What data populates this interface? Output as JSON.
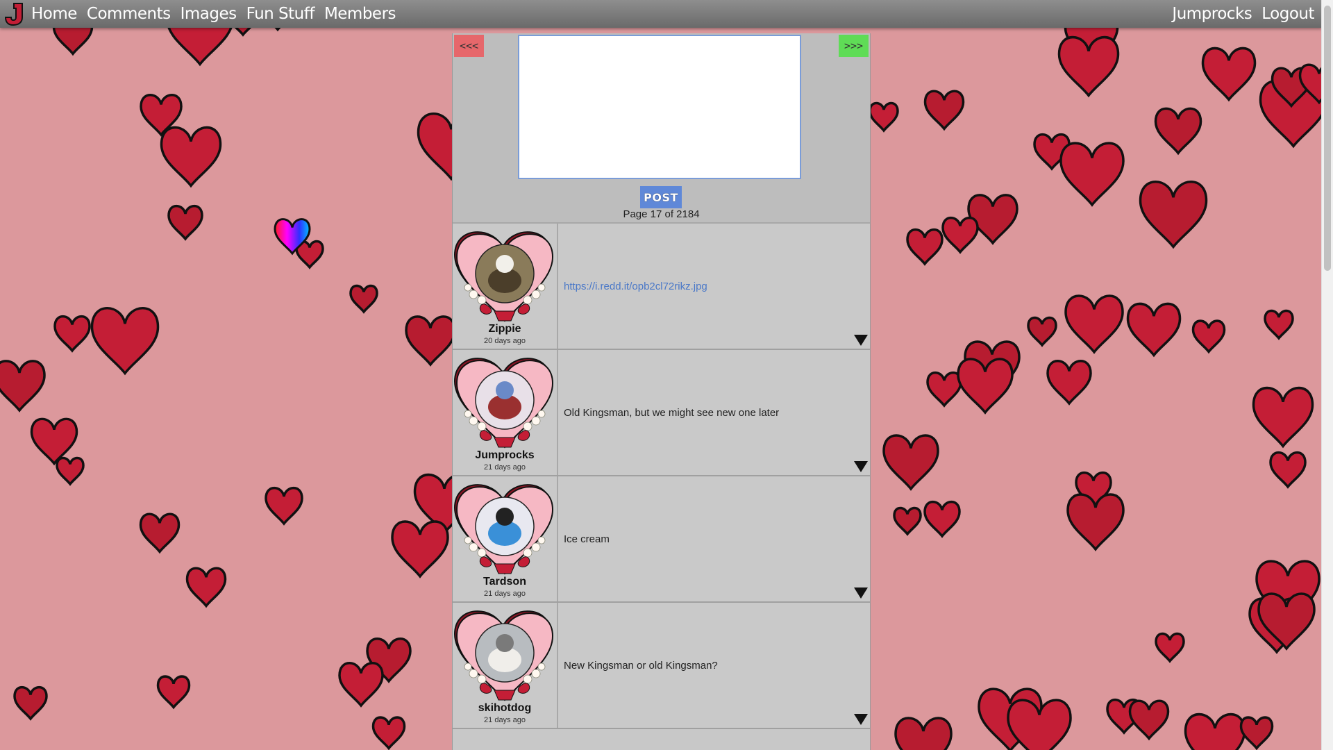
{
  "nav": {
    "logo_letter": "J",
    "links": [
      "Home",
      "Comments",
      "Images",
      "Fun Stuff",
      "Members"
    ],
    "user": "Jumprocks",
    "logout": "Logout"
  },
  "composer": {
    "prev_label": "<<<",
    "next_label": ">>>",
    "post_label": "POST",
    "page_info": "Page 17 of 2184",
    "textarea_value": ""
  },
  "comments": [
    {
      "author": "Zippie",
      "time": "20 days ago",
      "text": "https://i.redd.it/opb2cl72rikz.jpg",
      "is_link": true,
      "avatar": "cow-photo"
    },
    {
      "author": "Jumprocks",
      "time": "21 days ago",
      "text": "Old Kingsman, but we might see new one later",
      "is_link": false,
      "avatar": "cartoon-character"
    },
    {
      "author": "Tardson",
      "time": "21 days ago",
      "text": "Ice cream",
      "is_link": false,
      "avatar": "blue-pokemon"
    },
    {
      "author": "skihotdog",
      "time": "21 days ago",
      "text": "New Kingsman or old Kingsman?",
      "is_link": false,
      "avatar": "white-dog-photo"
    }
  ],
  "colors": {
    "background": "#dc989c",
    "heart": "#c41e36",
    "heart_outline": "#111111",
    "prev": "#e6676b",
    "next": "#5fdc56",
    "post": "#5f88d8",
    "link": "#4a78c8"
  }
}
